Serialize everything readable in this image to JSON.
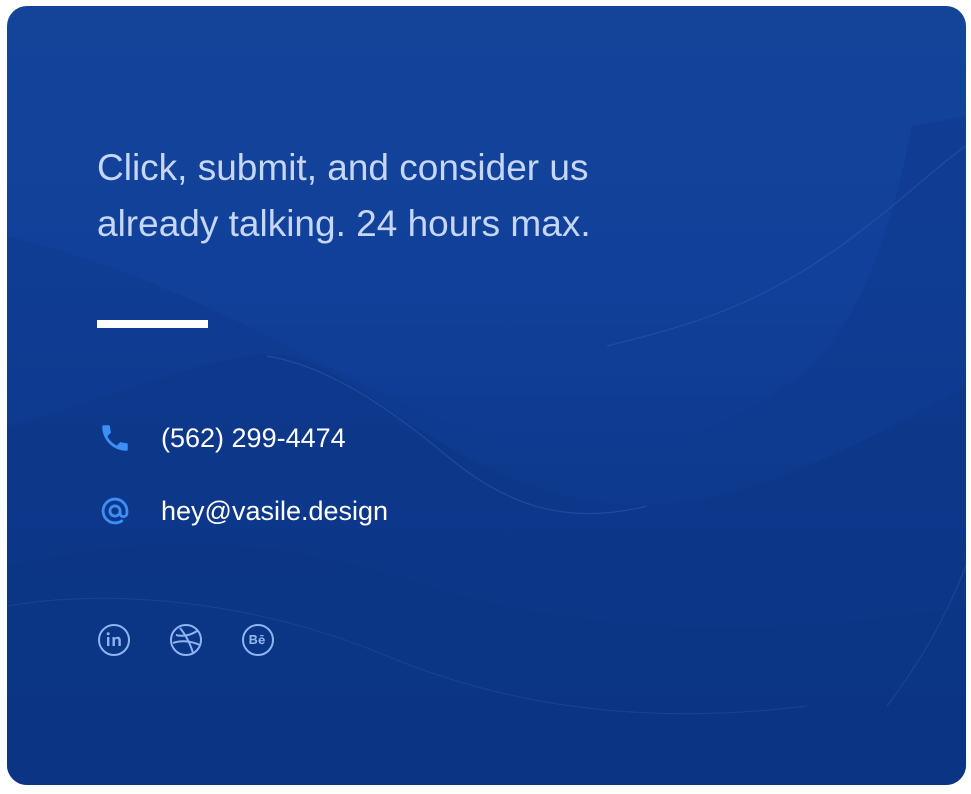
{
  "hero": {
    "headline_line1": "Click, submit, and consider us",
    "headline_line2": "already talking. 24 hours max."
  },
  "contact": {
    "phone": "(562) 299-4474",
    "email": "hey@vasile.design",
    "phone_icon": "phone-icon",
    "email_icon": "at-icon"
  },
  "socials": [
    {
      "icon": "linkedin-icon"
    },
    {
      "icon": "dribbble-icon"
    },
    {
      "icon": "behance-icon"
    }
  ],
  "colors": {
    "background": "#11409a",
    "headline": "#c6d6f5",
    "accent": "#3d8ef5",
    "text": "#ffffff",
    "social": "#8fb4f2"
  }
}
